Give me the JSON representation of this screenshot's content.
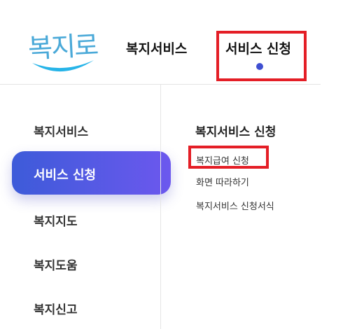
{
  "logo": {
    "text": "복지로",
    "color": "#4aa9d8",
    "swoosh_color": "#27b4e8"
  },
  "top_nav": {
    "items": [
      {
        "label": "복지서비스"
      },
      {
        "label": "서비스 신청",
        "active": true
      }
    ],
    "active_indicator_color": "#3f4fd1",
    "highlight_color": "#e41e26"
  },
  "sidebar": {
    "items": [
      {
        "label": "복지서비스"
      },
      {
        "label": "서비스 신청",
        "active": true
      },
      {
        "label": "복지지도"
      },
      {
        "label": "복지도움"
      },
      {
        "label": "복지신고"
      }
    ],
    "active_gradient": [
      "#3d5bd9",
      "#6c58ee"
    ]
  },
  "submenu": {
    "title": "복지서비스 신청",
    "items": [
      {
        "label": "복지급여 신청",
        "highlighted": true
      },
      {
        "label": "화면 따라하기"
      },
      {
        "label": "복지서비스 신청서식"
      }
    ]
  }
}
